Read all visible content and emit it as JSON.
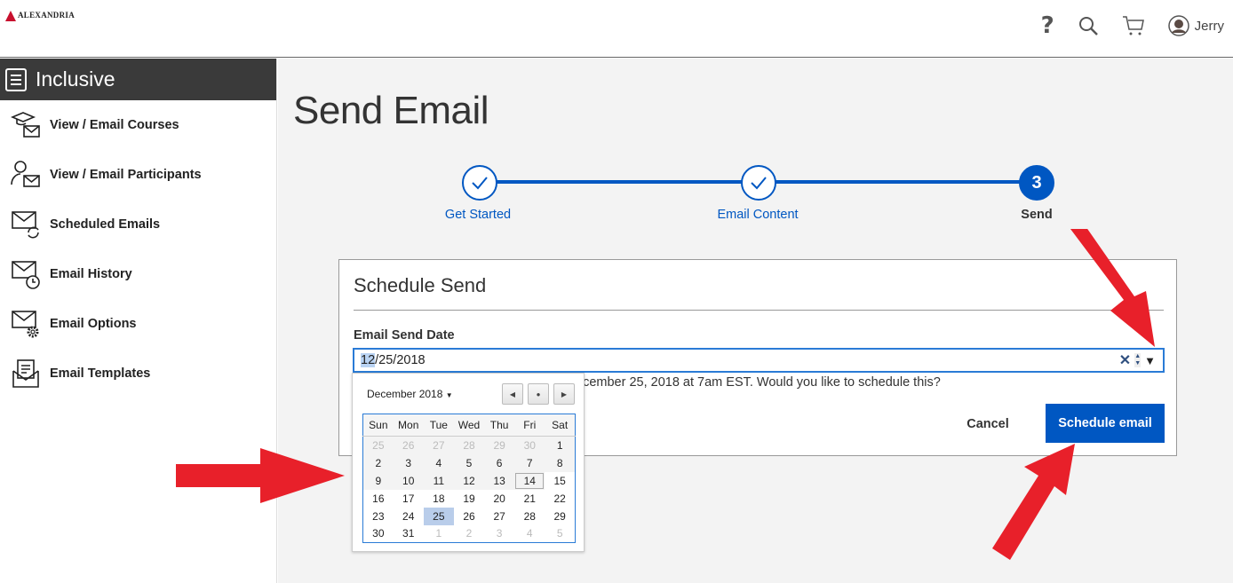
{
  "header": {
    "logo_text": "ALEXANDRIA",
    "user_name": "Jerry",
    "icons": [
      "help-icon",
      "search-icon",
      "cart-icon",
      "user-avatar-icon"
    ]
  },
  "sidebar": {
    "title": "Inclusive",
    "items": [
      {
        "label": "View / Email Courses",
        "icon": "graduation-cap-mail-icon"
      },
      {
        "label": "View / Email Participants",
        "icon": "person-mail-icon"
      },
      {
        "label": "Scheduled Emails",
        "icon": "mail-refresh-icon"
      },
      {
        "label": "Email History",
        "icon": "mail-clock-icon"
      },
      {
        "label": "Email Options",
        "icon": "mail-gear-icon"
      },
      {
        "label": "Email Templates",
        "icon": "mail-document-icon"
      }
    ]
  },
  "main": {
    "title": "Send Email",
    "steps": [
      {
        "label": "Get Started",
        "state": "done"
      },
      {
        "label": "Email Content",
        "state": "done"
      },
      {
        "label": "Send",
        "number": "3",
        "state": "current"
      }
    ],
    "card": {
      "title": "Schedule Send",
      "date_label": "Email Send Date",
      "date_month": "12",
      "date_rest": "/25/2018",
      "message": "ecember 25, 2018 at 7am EST. Would you like to schedule this?",
      "cancel": "Cancel",
      "schedule": "Schedule email"
    }
  },
  "calendar": {
    "month_label": "December 2018",
    "days": [
      "Sun",
      "Mon",
      "Tue",
      "Wed",
      "Thu",
      "Fri",
      "Sat"
    ],
    "weeks": [
      [
        "25",
        "26",
        "27",
        "28",
        "29",
        "30",
        "1"
      ],
      [
        "2",
        "3",
        "4",
        "5",
        "6",
        "7",
        "8"
      ],
      [
        "9",
        "10",
        "11",
        "12",
        "13",
        "14",
        "15"
      ],
      [
        "16",
        "17",
        "18",
        "19",
        "20",
        "21",
        "22"
      ],
      [
        "23",
        "24",
        "25",
        "26",
        "27",
        "28",
        "29"
      ],
      [
        "30",
        "31",
        "1",
        "2",
        "3",
        "4",
        "5"
      ]
    ],
    "today": "14",
    "selected": "25"
  },
  "colors": {
    "accent": "#0057c2",
    "sidebar_header": "#3a3a3a",
    "annotation_arrow": "#e8202a"
  }
}
